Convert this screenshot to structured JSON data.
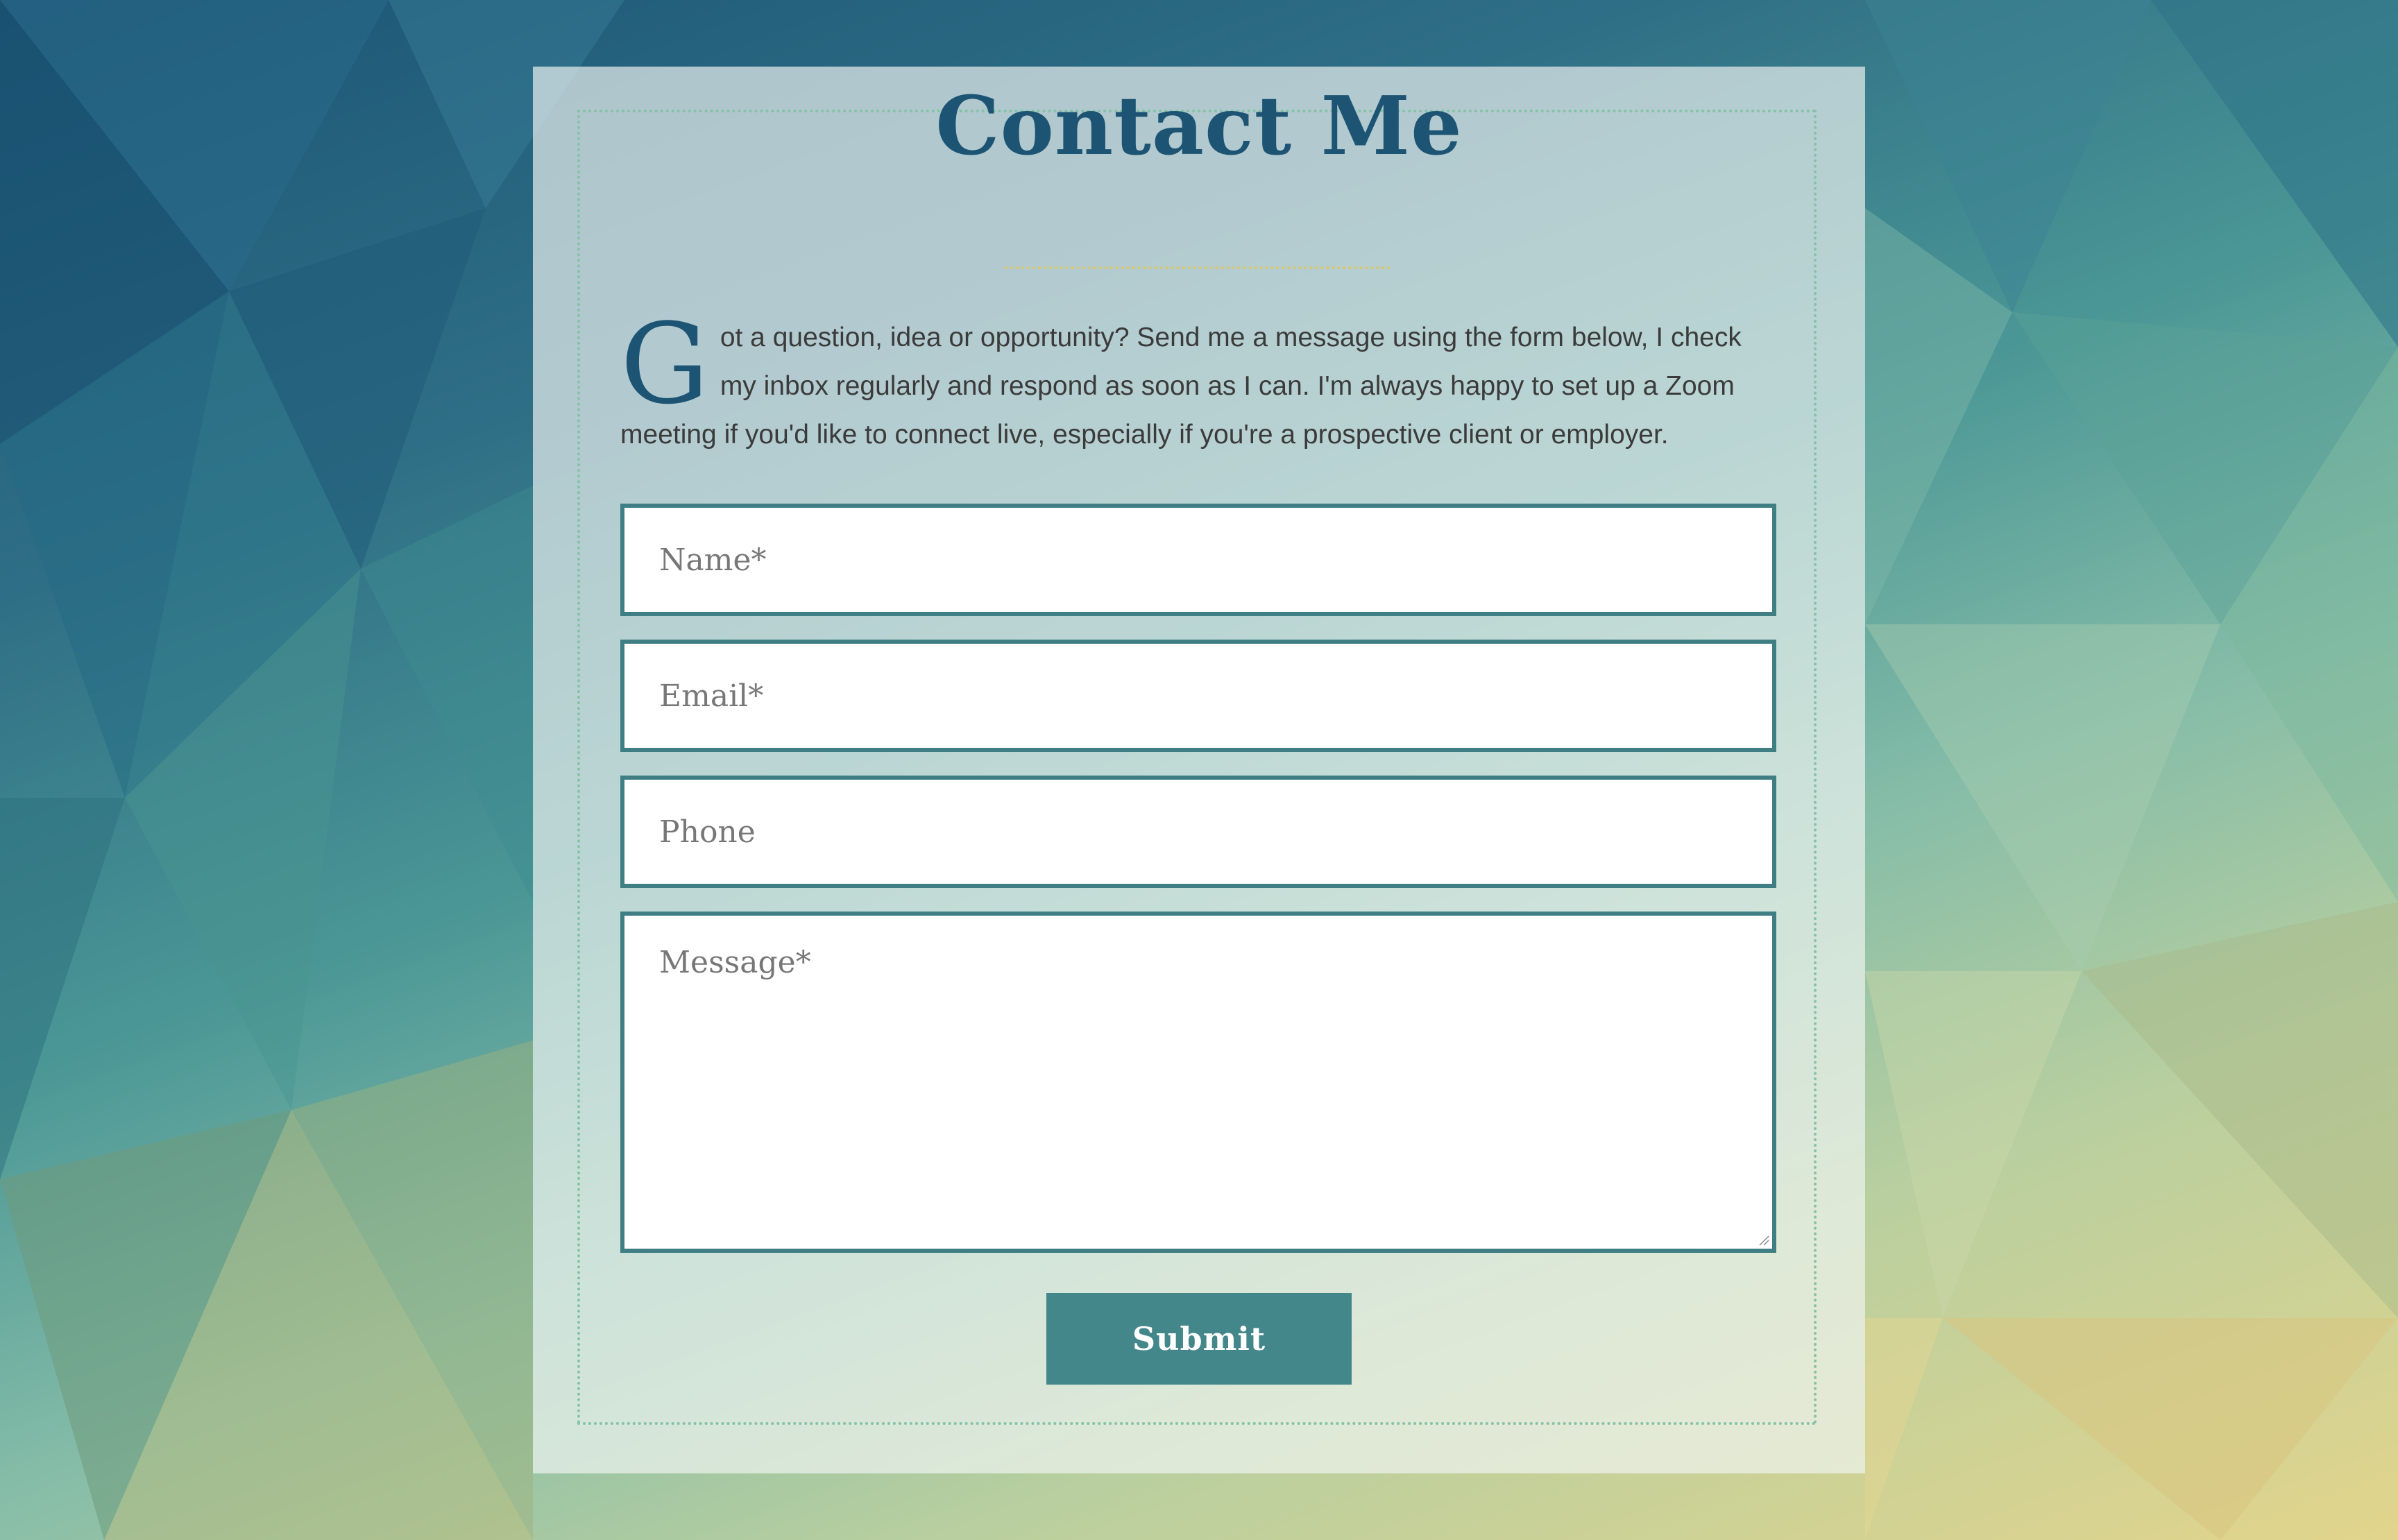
{
  "theme": {
    "title_color": "#1d5474",
    "accent_teal": "#44878b",
    "field_border": "#3f7f84",
    "dotted_border": "#84c2a6",
    "title_rule": "#d9c86a",
    "text_color": "#3b3b3b"
  },
  "contact": {
    "title": "Contact Me",
    "intro_dropcap": "G",
    "intro_rest": "ot a question, idea or opportunity? Send me a message using the form below, I check my inbox regularly and respond as soon as I can. I'm always happy to set up a Zoom meeting if you'd like to connect live, especially if you're a prospective client or employer."
  },
  "form": {
    "name_placeholder": "Name*",
    "email_placeholder": "Email*",
    "phone_placeholder": "Phone",
    "message_placeholder": "Message*",
    "submit_label": "Submit"
  }
}
